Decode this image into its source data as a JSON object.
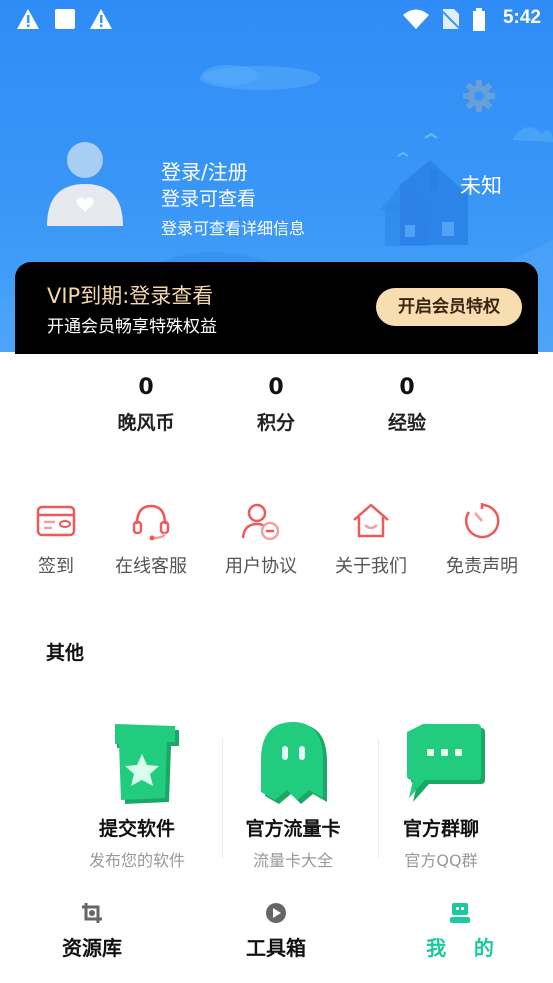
{
  "status_bar": {
    "time": "5:42",
    "icons": [
      "alert-icon",
      "square-icon",
      "alert-icon",
      "wifi-icon",
      "no-sim-icon",
      "battery-icon"
    ]
  },
  "header": {
    "settings_icon": "gear-icon",
    "avatar_icon": "avatar-placeholder-icon",
    "login_title": "登录/注册",
    "login_sub": "登录可查看",
    "login_desc": "登录可查看详细信息",
    "status": "未知"
  },
  "vip": {
    "title": "VIP到期:登录查看",
    "subtitle": "开通会员畅享特殊权益",
    "button": "开启会员特权",
    "bg_color": "#000000",
    "button_color": "#f8ddb0"
  },
  "stats": [
    {
      "value": "0",
      "label": "晚风币"
    },
    {
      "value": "0",
      "label": "积分"
    },
    {
      "value": "0",
      "label": "经验"
    }
  ],
  "menu": [
    {
      "label": "签到",
      "icon": "card-icon"
    },
    {
      "label": "在线客服",
      "icon": "headset-icon"
    },
    {
      "label": "用户协议",
      "icon": "user-minus-icon"
    },
    {
      "label": "关于我们",
      "icon": "home-smile-icon"
    },
    {
      "label": "免责声明",
      "icon": "timer-icon"
    }
  ],
  "section": {
    "title": "其他"
  },
  "apps": [
    {
      "name": "提交软件",
      "desc": "发布您的软件",
      "icon": "star-box-icon"
    },
    {
      "name": "官方流量卡",
      "desc": "流量卡大全",
      "icon": "ghost-icon"
    },
    {
      "name": "官方群聊",
      "desc": "官方QQ群",
      "icon": "chat-bubble-icon"
    }
  ],
  "tabs": [
    {
      "label": "资源库",
      "icon": "crop-icon",
      "active": false
    },
    {
      "label": "工具箱",
      "icon": "play-icon",
      "active": false
    },
    {
      "label": "我    的",
      "icon": "robot-icon",
      "active": true
    }
  ],
  "colors": {
    "header_blue": "#3a97f7",
    "menu_red": "#ee5a5a",
    "app_green": "#1ec47a",
    "tab_active": "#1cc8a0",
    "tab_inactive": "#111111"
  }
}
